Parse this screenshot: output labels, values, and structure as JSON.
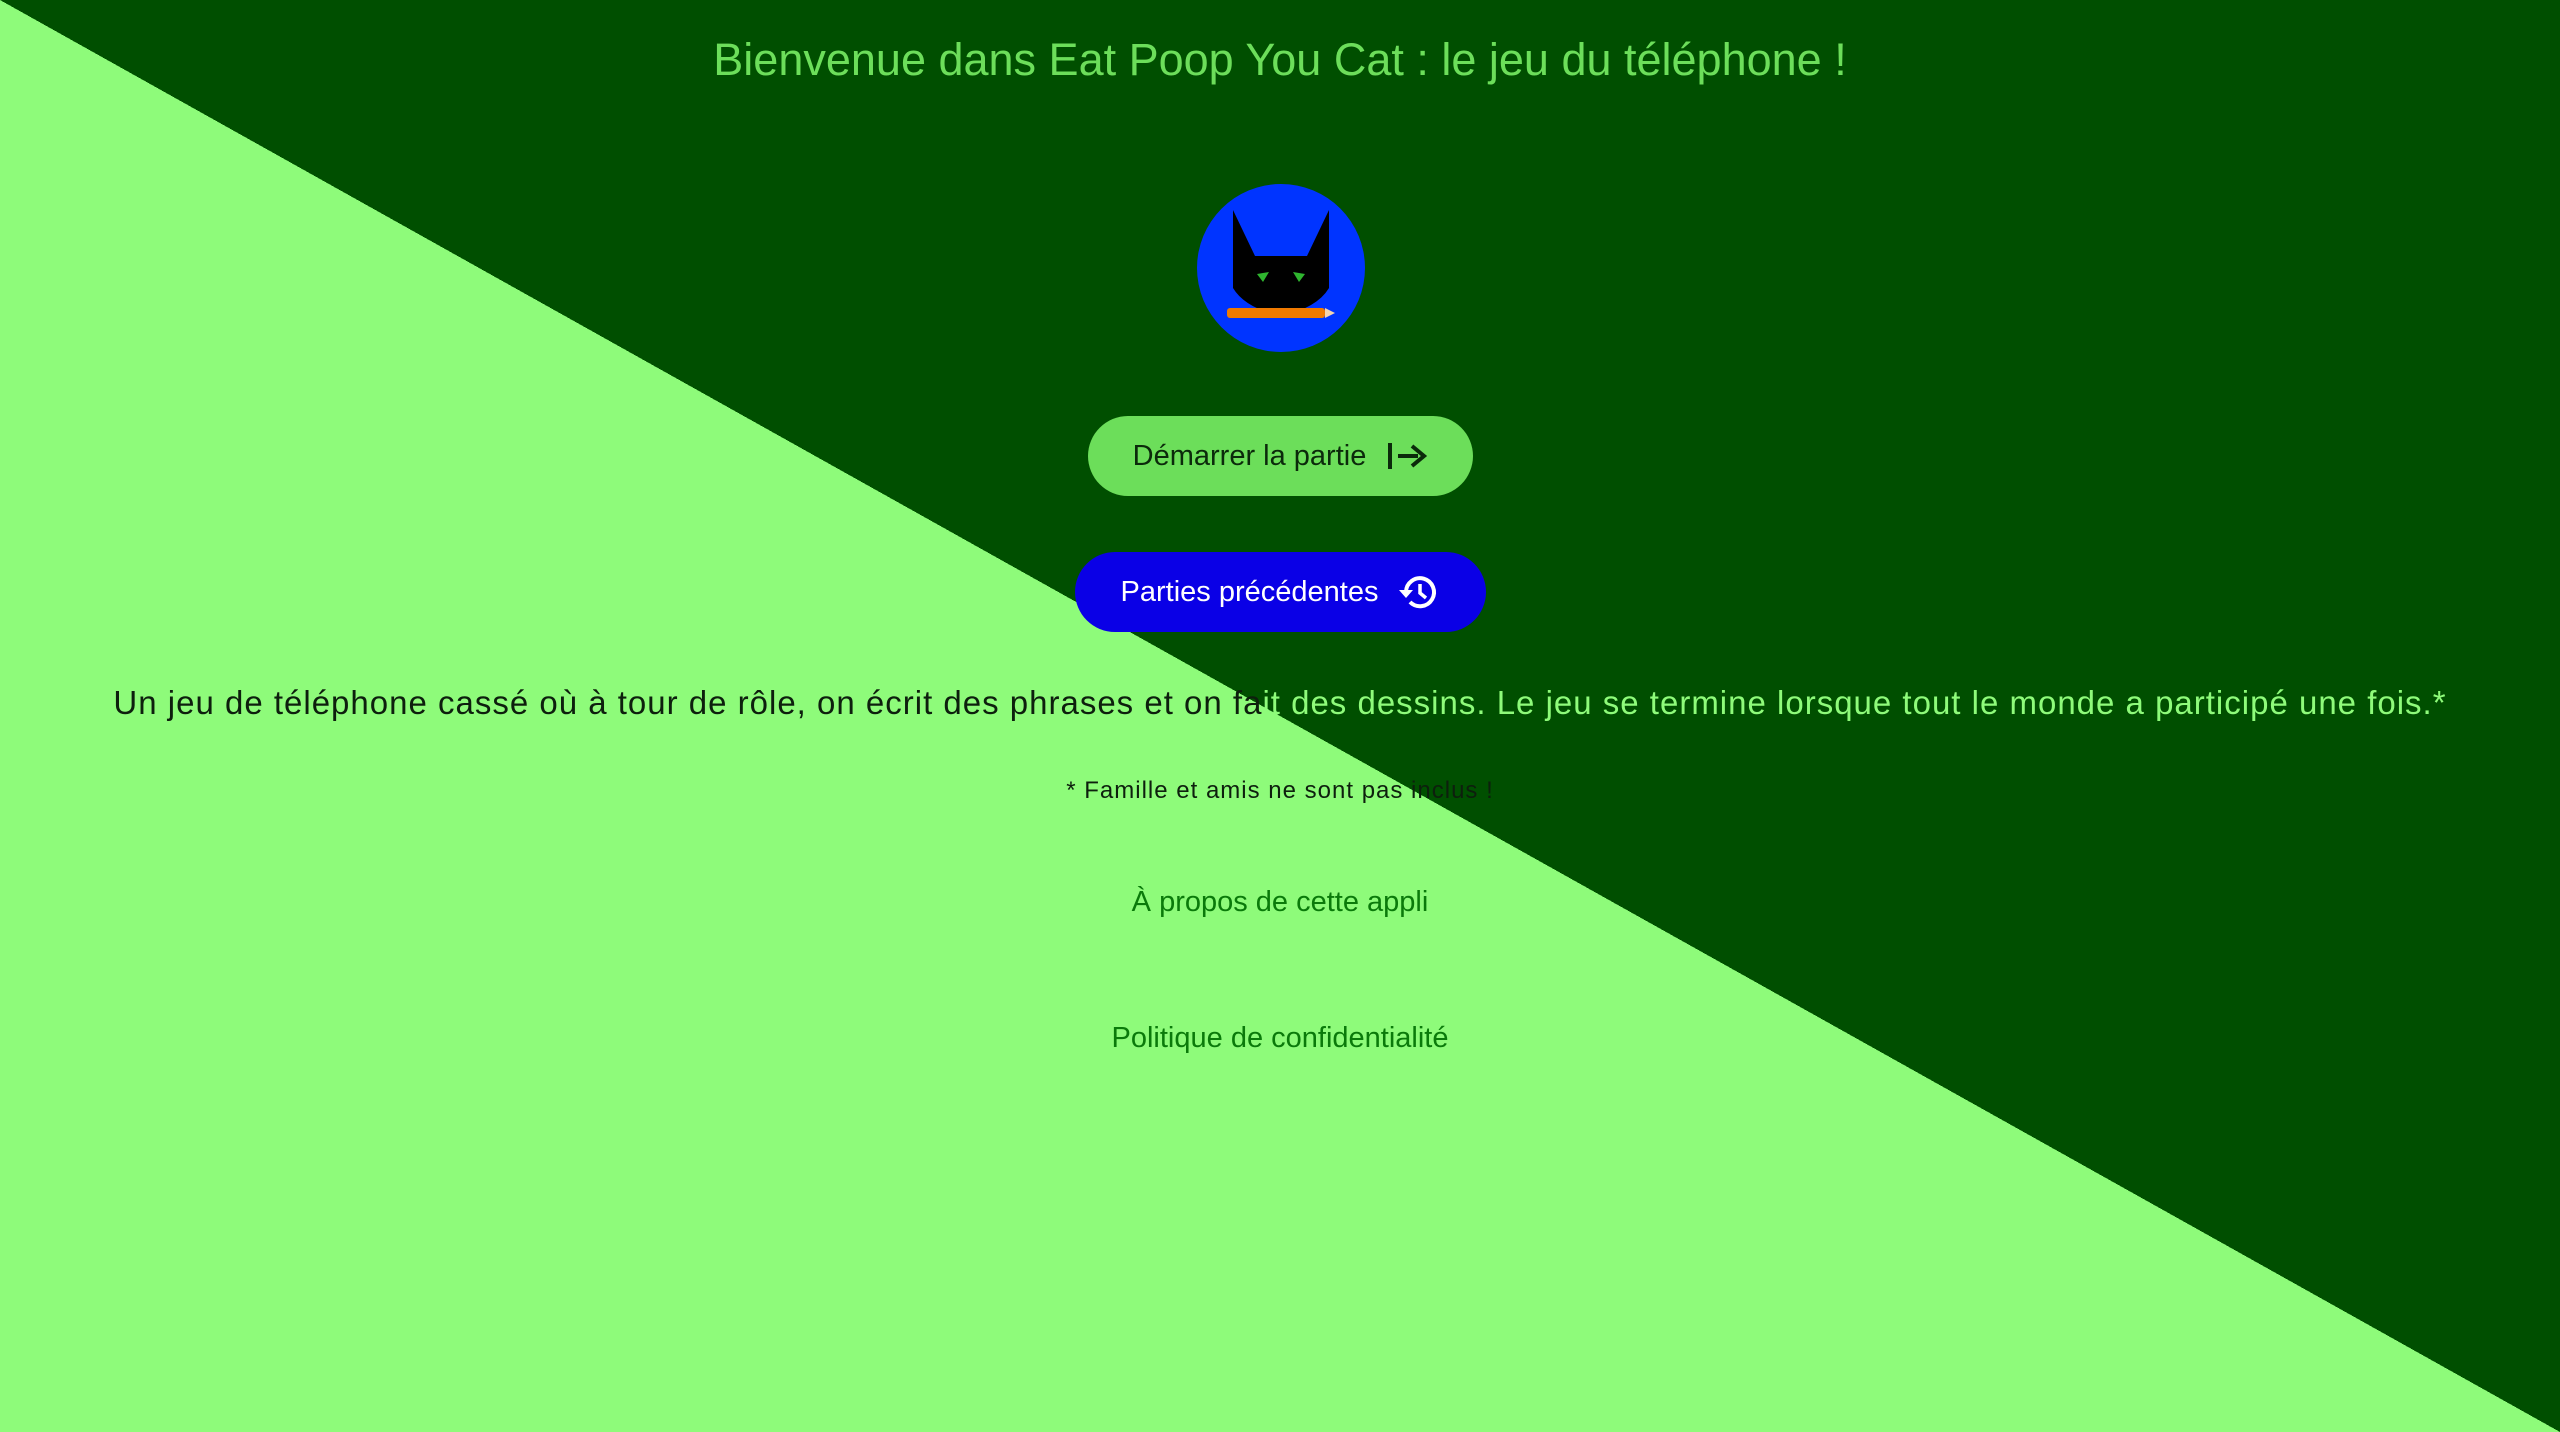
{
  "header": {
    "title": "Bienvenue dans Eat Poop You Cat : le jeu du téléphone !"
  },
  "logo": {
    "icon": "cat-with-pencil-logo"
  },
  "actions": {
    "start_label": "Démarrer la partie",
    "start_icon": "arrow-right-to-bar-icon",
    "history_label": "Parties précédentes",
    "history_icon": "history-icon"
  },
  "description": {
    "part1": "Un jeu de téléphone cassé où à tour de rôle, on écrit des phrases et on fa",
    "part2": "it des dessins. Le jeu se termine lorsque tout le monde a participé une fois.*",
    "note": "* Famille et amis ne sont pas inclus !"
  },
  "links": {
    "about": "À propos de cette appli",
    "privacy": "Politique de confidentialité"
  },
  "colors": {
    "dark_green": "#004f00",
    "light_green": "#8efb7a",
    "accent_green": "#6cde5a",
    "blue_button": "#0a00e6",
    "logo_blue": "#0034ff",
    "link_green": "#0a7a0a"
  }
}
